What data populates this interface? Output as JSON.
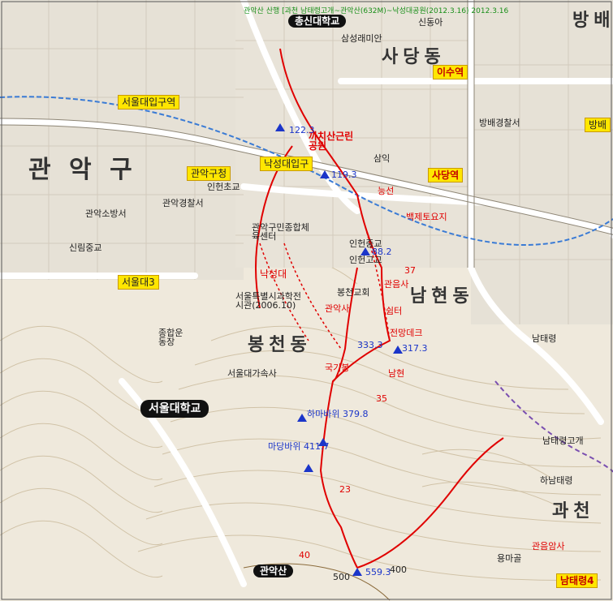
{
  "map_title": "관악산 산행 [과천 남태령고개~관악산(632M)~낙성대공원(2012.3.16) 2012.3.16",
  "colors": {
    "hiking_route": "#e00000",
    "main_road": "#ffffff",
    "road_fill": "#cfc9bd",
    "urban": "#e8e4dc",
    "terrain": "#f0ece2",
    "station_box": "#ffe600"
  },
  "districts": [
    {
      "text": "관 악 구"
    },
    {
      "text": "사당동"
    },
    {
      "text": "남현동"
    },
    {
      "text": "봉천동"
    },
    {
      "text": "과천"
    },
    {
      "text": "방배"
    }
  ],
  "stations": [
    {
      "text": "서울대입구역"
    },
    {
      "text": "낙성대입구"
    },
    {
      "text": "사당역"
    },
    {
      "text": "이수역"
    },
    {
      "text": "서울대3"
    },
    {
      "text": "관악구청"
    },
    {
      "text": "방배"
    },
    {
      "text": "남태령4"
    }
  ],
  "landmarks": [
    {
      "text": "서울대학교"
    },
    {
      "text": "관악산"
    },
    {
      "text": "총신대학교"
    },
    {
      "text": "까치산근린공원"
    },
    {
      "text": "관음사"
    },
    {
      "text": "백제토요지"
    },
    {
      "text": "낙성대"
    },
    {
      "text": "서울특별시과학전시관(2006.10)"
    },
    {
      "text": "서울대가속사"
    },
    {
      "text": "종합운동장"
    },
    {
      "text": "관악구민종합체육센터"
    },
    {
      "text": "인헌초교"
    },
    {
      "text": "인헌중교"
    },
    {
      "text": "인헌고교"
    },
    {
      "text": "봉천교회"
    },
    {
      "text": "남태령"
    },
    {
      "text": "관악사"
    },
    {
      "text": "용마골"
    },
    {
      "text": "관음암사"
    },
    {
      "text": "남태령고개"
    },
    {
      "text": "하남태령"
    },
    {
      "text": "삼성래미안"
    },
    {
      "text": "방배경찰서"
    },
    {
      "text": "신동아"
    },
    {
      "text": "삼익"
    },
    {
      "text": "신림중교"
    },
    {
      "text": "관악소방서"
    },
    {
      "text": "관악경찰서"
    }
  ],
  "peaks": [
    {
      "text": "하마바위",
      "height": "379.8"
    },
    {
      "text": "마당바위",
      "height": "411.7"
    },
    {
      "text": "317.3",
      "height": "317.3"
    },
    {
      "text": "333.3",
      "height": "333.3"
    },
    {
      "text": "559.3",
      "height": "559.3"
    },
    {
      "text": "119.3",
      "height": "119.3"
    },
    {
      "text": "122.3",
      "height": "122.3"
    },
    {
      "text": "88.2",
      "height": "88.2"
    }
  ],
  "contours": [
    "500",
    "400",
    "40",
    "35",
    "23",
    "37"
  ],
  "route_labels": [
    "전망데크",
    "쉼터",
    "국기봉",
    "남현",
    "능선"
  ]
}
